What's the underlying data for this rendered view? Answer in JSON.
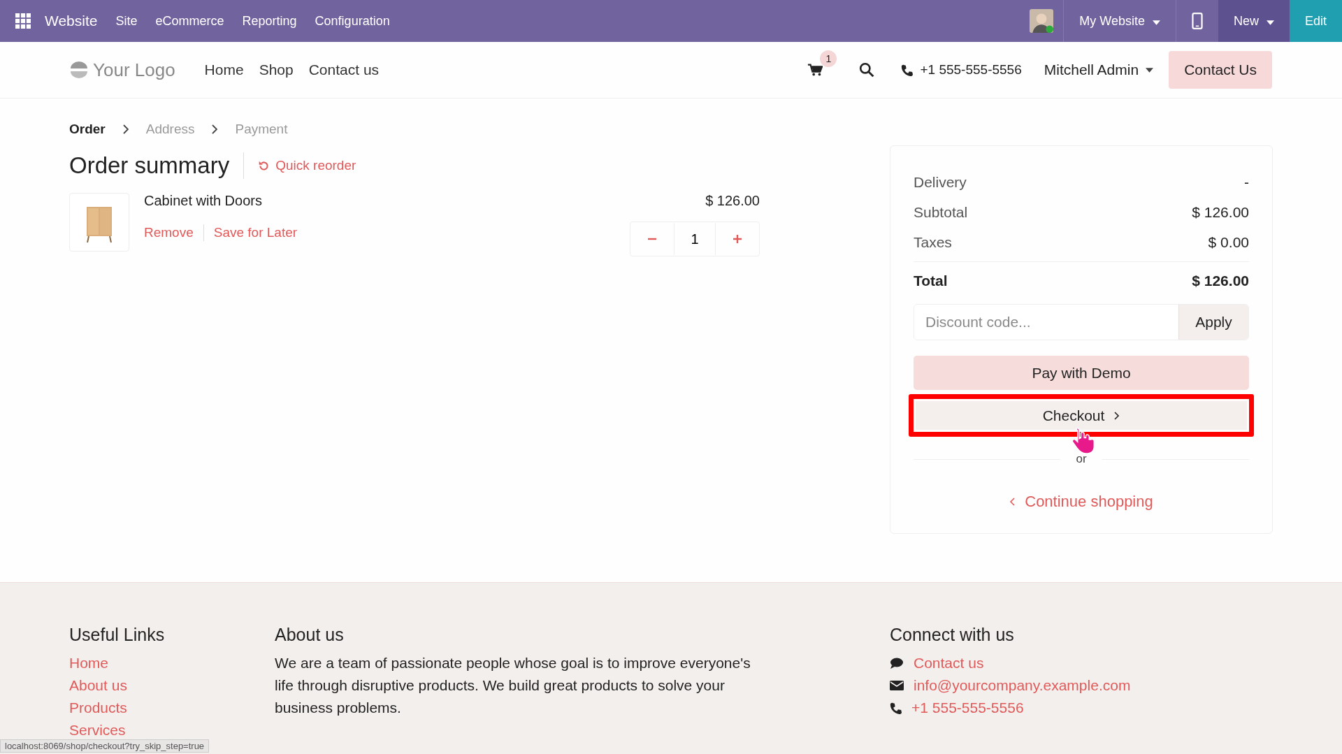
{
  "topbar": {
    "app": "Website",
    "menu": [
      "Site",
      "eCommerce",
      "Reporting",
      "Configuration"
    ],
    "website_switcher": "My Website",
    "new_button": "New",
    "edit_button": "Edit"
  },
  "header": {
    "logo": "Your Logo",
    "nav": [
      "Home",
      "Shop",
      "Contact us"
    ],
    "cart_count": "1",
    "phone": "+1 555-555-5556",
    "user": "Mitchell Admin",
    "cta": "Contact Us"
  },
  "breadcrumb": [
    {
      "label": "Order",
      "selected": true
    },
    {
      "label": "Address",
      "selected": false
    },
    {
      "label": "Payment",
      "selected": false
    }
  ],
  "title": "Order summary",
  "quick_reorder": "Quick reorder",
  "lines": [
    {
      "name": "Cabinet with Doors",
      "price": "$ 126.00",
      "quantity": "1",
      "actions": [
        "Remove",
        "Save for Later"
      ]
    }
  ],
  "summary": {
    "rows": [
      {
        "label": "Delivery",
        "value": "-",
        "kind": "normal"
      },
      {
        "label": "Subtotal",
        "value": "$ 126.00",
        "kind": "normal"
      },
      {
        "label": "Taxes",
        "value": "$ 0.00",
        "kind": "normal"
      },
      {
        "label": "Total",
        "value": "$ 126.00",
        "kind": "total"
      }
    ],
    "discount_placeholder": "Discount code...",
    "apply": "Apply",
    "pay_button": "Pay with Demo",
    "checkout": "Checkout",
    "separator": "or",
    "continue": "Continue shopping"
  },
  "footer": {
    "columns": [
      {
        "title": "Useful Links",
        "links": [
          "Home",
          "About us",
          "Products",
          "Services"
        ]
      },
      {
        "title": "About us",
        "text": "We are a team of passionate people whose goal is to improve everyone's life through disruptive products. We build great products to solve your business problems."
      },
      {
        "title": "Connect with us",
        "contacts": [
          {
            "kind": "chat",
            "label": "Contact us"
          },
          {
            "kind": "mail",
            "label": "info@yourcompany.example.com"
          },
          {
            "kind": "phone",
            "label": "+1 555-555-5556"
          }
        ]
      }
    ]
  },
  "status_url": "localhost:8069/shop/checkout?try_skip_step=true"
}
